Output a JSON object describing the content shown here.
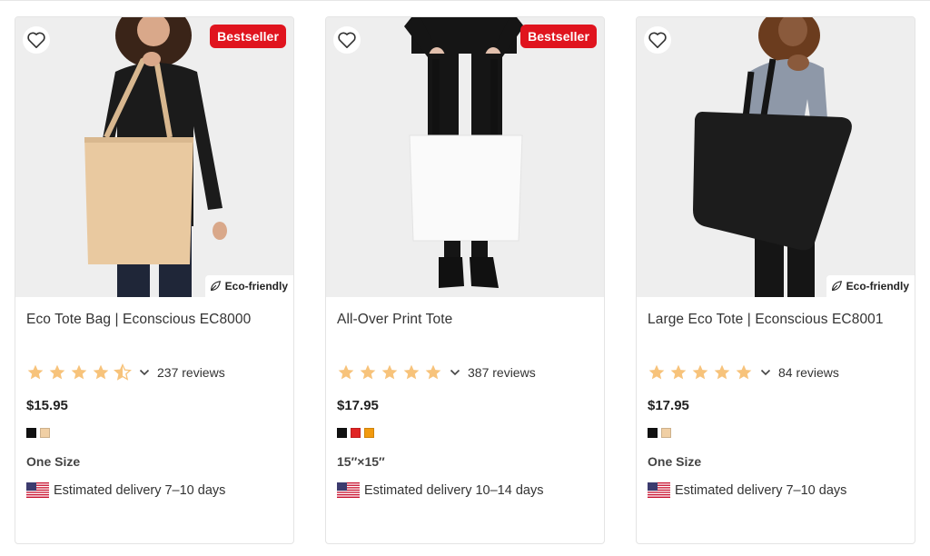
{
  "products": [
    {
      "title": "Eco Tote Bag | Econscious EC8000",
      "badge": "Bestseller",
      "eco_label": "Eco-friendly",
      "rating": 4.5,
      "reviews": "237 reviews",
      "price": "$15.95",
      "colors": [
        "#111111",
        "#f0cfa4"
      ],
      "size_text": "One Size",
      "delivery": "Estimated delivery 7–10 days",
      "bag_color": "#e9c9a0"
    },
    {
      "title": "All-Over Print Tote",
      "badge": "Bestseller",
      "eco_label": "",
      "rating": 5,
      "reviews": "387 reviews",
      "price": "$17.95",
      "colors": [
        "#111111",
        "#e02424",
        "#f29a0e"
      ],
      "size_text": "15″×15″",
      "delivery": "Estimated delivery 10–14 days",
      "bag_color": "#fafafa"
    },
    {
      "title": "Large Eco Tote | Econscious EC8001",
      "badge": "",
      "eco_label": "Eco-friendly",
      "rating": 5,
      "reviews": "84 reviews",
      "price": "$17.95",
      "colors": [
        "#111111",
        "#f0cfa4"
      ],
      "size_text": "One Size",
      "delivery": "Estimated delivery 7–10 days",
      "bag_color": "#1c1c1c"
    }
  ],
  "icons": {
    "favorite": "heart-outline-icon",
    "eco": "leaf-icon",
    "star": "star-icon",
    "expand": "chevron-down-icon",
    "flag": "us-flag-icon"
  },
  "colors": {
    "badge": "#e0141e",
    "star": "#f7c37b",
    "star_empty": "#dedede"
  }
}
